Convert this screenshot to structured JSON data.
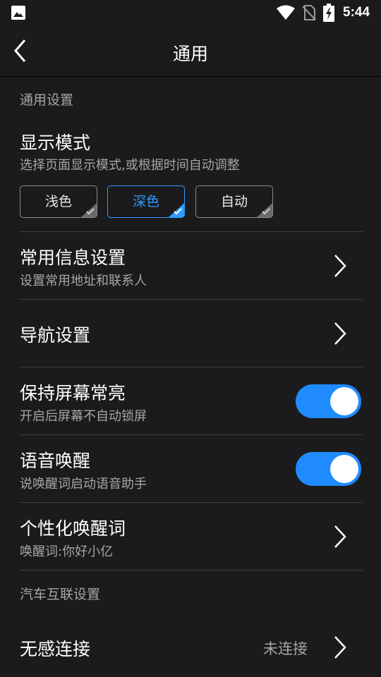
{
  "status_bar": {
    "time": "5:44"
  },
  "header": {
    "title": "通用"
  },
  "sections": {
    "general_settings": "通用设置",
    "car_connect_settings": "汽车互联设置"
  },
  "display_mode": {
    "title": "显示模式",
    "subtitle": "选择页面显示模式,或根据时间自动调整",
    "options": [
      "浅色",
      "深色",
      "自动"
    ],
    "selected": "深色"
  },
  "common_info": {
    "title": "常用信息设置",
    "subtitle": "设置常用地址和联系人"
  },
  "navigation": {
    "title": "导航设置"
  },
  "keep_screen_on": {
    "title": "保持屏幕常亮",
    "subtitle": "开启后屏幕不自动锁屏",
    "enabled": true
  },
  "voice_wakeup": {
    "title": "语音唤醒",
    "subtitle": "说唤醒词启动语音助手",
    "enabled": true
  },
  "custom_wake_word": {
    "title": "个性化唤醒词",
    "subtitle": "唤醒词:你好小亿"
  },
  "seamless_connect": {
    "title": "无感连接",
    "value": "未连接"
  },
  "colors": {
    "background": "#1b1b1d",
    "accent": "#1f8bff",
    "secondary_text": "#a6a6a6"
  }
}
